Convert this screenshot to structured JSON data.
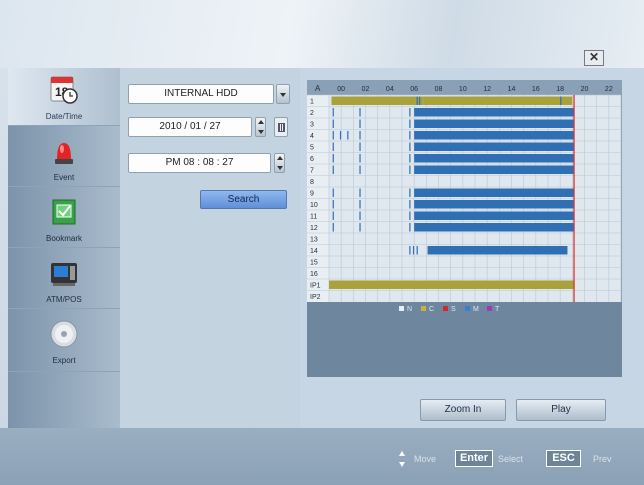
{
  "window": {
    "close_symbol": "✕"
  },
  "sidebar": {
    "items": [
      {
        "label": "Date/Time",
        "icon": "calendar-clock-icon",
        "active": true
      },
      {
        "label": "Event",
        "icon": "alarm-siren-icon",
        "active": false
      },
      {
        "label": "Bookmark",
        "icon": "bookmark-check-icon",
        "active": false
      },
      {
        "label": "ATM/POS",
        "icon": "atm-terminal-icon",
        "active": false
      },
      {
        "label": "Export",
        "icon": "disc-icon",
        "active": false
      }
    ],
    "calendar_day": "18"
  },
  "search": {
    "storage": "INTERNAL HDD",
    "date": "2010  /  01  /  27",
    "time": "PM    08  :  08  :  27",
    "button_label": "Search"
  },
  "timeline": {
    "corner_label": "A",
    "hours": [
      "00",
      "02",
      "04",
      "06",
      "08",
      "10",
      "12",
      "14",
      "16",
      "18",
      "20",
      "22"
    ],
    "rows": [
      "1",
      "2",
      "3",
      "4",
      "5",
      "6",
      "7",
      "8",
      "9",
      "10",
      "11",
      "12",
      "13",
      "14",
      "15",
      "16",
      "IP1",
      "IP2"
    ],
    "legend": [
      {
        "code": "N",
        "color": "#e8eef4"
      },
      {
        "code": "C",
        "color": "#c9b13a"
      },
      {
        "code": "S",
        "color": "#d22a2a"
      },
      {
        "code": "M",
        "color": "#3a7fd0"
      },
      {
        "code": "T",
        "color": "#a03ab0"
      }
    ],
    "current_time_hour": 20.14,
    "colors": {
      "normal": "#2f6fb3",
      "continuous": "#a9a23b",
      "cursor": "#e0302c"
    },
    "recordings": [
      {
        "row": 0,
        "segments": [
          [
            0.2,
            7.0,
            "c"
          ],
          [
            7.0,
            7.8,
            "c"
          ],
          [
            7.8,
            20.0,
            "c"
          ]
        ],
        "marks": [
          7.2,
          7.4,
          19.0
        ]
      },
      {
        "row": 1,
        "segments": [
          [
            7.0,
            20.14,
            "n"
          ]
        ],
        "marks": [
          0.3,
          2.5,
          6.6
        ]
      },
      {
        "row": 2,
        "segments": [
          [
            7.0,
            20.14,
            "n"
          ]
        ],
        "marks": [
          0.3,
          2.5,
          6.6
        ]
      },
      {
        "row": 3,
        "segments": [
          [
            7.0,
            20.14,
            "n"
          ]
        ],
        "marks": [
          0.3,
          0.9,
          1.5,
          2.5,
          6.6
        ]
      },
      {
        "row": 4,
        "segments": [
          [
            7.0,
            20.14,
            "n"
          ]
        ],
        "marks": [
          0.3,
          2.5,
          6.6
        ]
      },
      {
        "row": 5,
        "segments": [
          [
            7.0,
            20.14,
            "n"
          ]
        ],
        "marks": [
          0.3,
          2.5,
          6.6
        ]
      },
      {
        "row": 6,
        "segments": [
          [
            7.0,
            20.14,
            "n"
          ]
        ],
        "marks": [
          0.3,
          2.5,
          6.6
        ]
      },
      {
        "row": 8,
        "segments": [
          [
            7.0,
            20.14,
            "n"
          ]
        ],
        "marks": [
          0.3,
          2.5,
          6.6
        ]
      },
      {
        "row": 9,
        "segments": [
          [
            7.0,
            20.14,
            "n"
          ]
        ],
        "marks": [
          0.3,
          2.5,
          6.6
        ]
      },
      {
        "row": 10,
        "segments": [
          [
            7.0,
            20.14,
            "n"
          ]
        ],
        "marks": [
          0.3,
          2.5,
          6.6
        ]
      },
      {
        "row": 11,
        "segments": [
          [
            7.0,
            20.14,
            "n"
          ]
        ],
        "marks": [
          0.3,
          2.5,
          6.6
        ]
      },
      {
        "row": 13,
        "segments": [
          [
            8.1,
            19.6,
            "n"
          ]
        ],
        "marks": [
          6.6,
          6.9,
          7.2,
          13.2,
          13.8,
          16.8,
          17.1
        ]
      },
      {
        "row": 16,
        "segments": [
          [
            0.0,
            20.14,
            "c"
          ]
        ],
        "marks": []
      }
    ]
  },
  "actions": {
    "zoom_in": "Zoom In",
    "play": "Play"
  },
  "footer": {
    "move": "Move",
    "enter": "Enter",
    "select": "Select",
    "esc": "ESC",
    "prev": "Prev"
  }
}
